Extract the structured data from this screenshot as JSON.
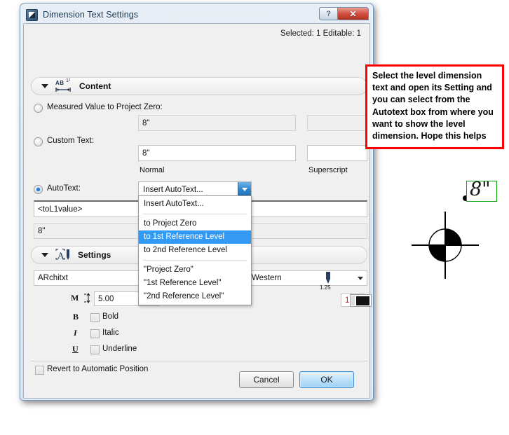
{
  "window": {
    "title": "Dimension Text Settings",
    "help_button": "?",
    "close_button": "✕",
    "status": "Selected: 1 Editable: 1"
  },
  "content_section": {
    "title": "Content",
    "measured_value": {
      "label": "Measured Value to Project Zero:",
      "selected": false,
      "normal_value": "8\"",
      "superscript_value": ""
    },
    "custom_text": {
      "label": "Custom Text:",
      "selected": false,
      "normal_value": "8\"",
      "superscript_value": ""
    },
    "column_labels": {
      "normal": "Normal",
      "superscript": "Superscript"
    },
    "autotext": {
      "label": "AutoText:",
      "selected": true,
      "combo_value": "Insert AutoText...",
      "code_value": "<toL1value>",
      "preview_value": "8\"",
      "options": [
        {
          "label": "Insert AutoText...",
          "selected": false,
          "separator_after": true
        },
        {
          "label": "to Project Zero",
          "selected": false,
          "separator_after": false
        },
        {
          "label": "to  1st Reference Level",
          "selected": true,
          "separator_after": false
        },
        {
          "label": "to 2nd Reference Level",
          "selected": false,
          "separator_after": true
        },
        {
          "label": "\"Project Zero\"",
          "selected": false,
          "separator_after": false
        },
        {
          "label": "\"1st Reference Level\"",
          "selected": false,
          "separator_after": false
        },
        {
          "label": "\"2nd Reference Level\"",
          "selected": false,
          "separator_after": false
        }
      ]
    }
  },
  "settings_section": {
    "title": "Settings",
    "font_family": "ARchitxt",
    "script": "Western",
    "font_size": "5.00",
    "pen_weight_label": "1.25",
    "pen_number": "1",
    "styles": [
      {
        "glyph": "B",
        "label": "Bold",
        "checked": false
      },
      {
        "glyph": "I",
        "label": "Italic",
        "checked": false
      },
      {
        "glyph": "U",
        "label": "Underline",
        "checked": false
      }
    ],
    "revert": {
      "label": "Revert to Automatic Position",
      "checked": false
    }
  },
  "buttons": {
    "cancel": "Cancel",
    "ok": "OK"
  },
  "annotation": {
    "text": "Select the level dimension text and open its Setting and you can select from the Autotext box from where you want to show the level dimension. Hope this helps",
    "border_color": "#ff0000"
  },
  "canvas": {
    "level_text": "8\"",
    "selection_color": "#12a012"
  }
}
